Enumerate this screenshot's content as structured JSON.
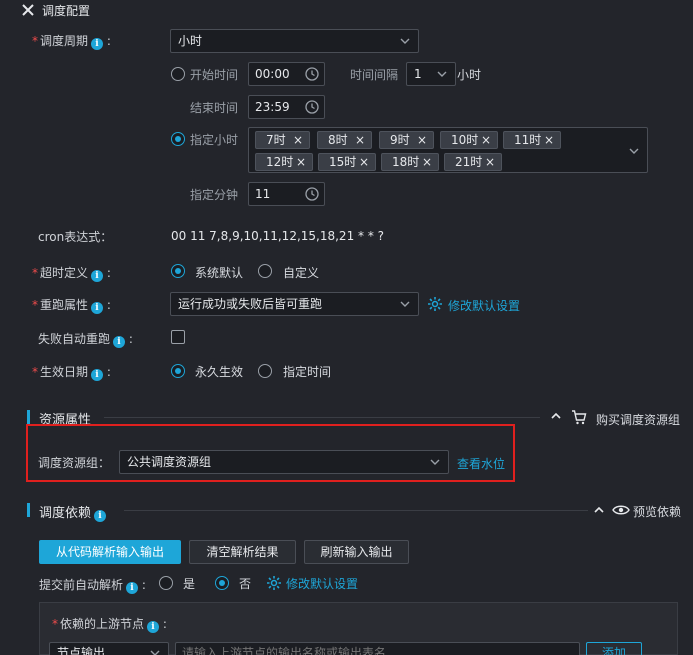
{
  "header": {
    "title": "调度配置"
  },
  "schedule_cycle": {
    "label": "调度周期",
    "value": "小时"
  },
  "start_time": {
    "label": "开始时间",
    "value": "00:00"
  },
  "interval": {
    "label": "时间间隔",
    "value": "1",
    "unit": "小时"
  },
  "end_time": {
    "label": "结束时间",
    "value": "23:59"
  },
  "specified_hours": {
    "label": "指定小时",
    "tags": [
      "7时",
      "8时",
      "9时",
      "10时",
      "11时",
      "12时",
      "15时",
      "18时",
      "21时"
    ]
  },
  "specified_minute": {
    "label": "指定分钟",
    "value": "11"
  },
  "cron": {
    "label": "cron表达式：",
    "value": "00 11 7,8,9,10,11,12,15,18,21 * * ?"
  },
  "timeout": {
    "label": "超时定义",
    "options": [
      "系统默认",
      "自定义"
    ]
  },
  "rerun": {
    "label": "重跑属性",
    "value": "运行成功或失败后皆可重跑",
    "link": "修改默认设置"
  },
  "auto_rerun": {
    "label": "失败自动重跑"
  },
  "effective_date": {
    "label": "生效日期",
    "options": [
      "永久生效",
      "指定时间"
    ]
  },
  "resource_section": {
    "title": "资源属性",
    "buy_link": "购买调度资源组",
    "group_label": "调度资源组：",
    "group_value": "公共调度资源组",
    "water_link": "查看水位"
  },
  "dependency_section": {
    "title": "调度依赖",
    "preview_link": "预览依赖",
    "buttons": [
      "从代码解析输入输出",
      "清空解析结果",
      "刷新输入输出"
    ],
    "auto_parse_label": "提交前自动解析",
    "auto_parse_options": [
      "是",
      "否"
    ],
    "modify_link": "修改默认设置",
    "upstream_label": "依赖的上游节点",
    "node_type": "节点输出",
    "upstream_placeholder": "请输入上游节点的输出名称或输出表名",
    "add_button": "添加"
  },
  "colors": {
    "accent": "#1ea6d8",
    "required": "#f04c4c",
    "highlight_border": "#e0201e"
  }
}
